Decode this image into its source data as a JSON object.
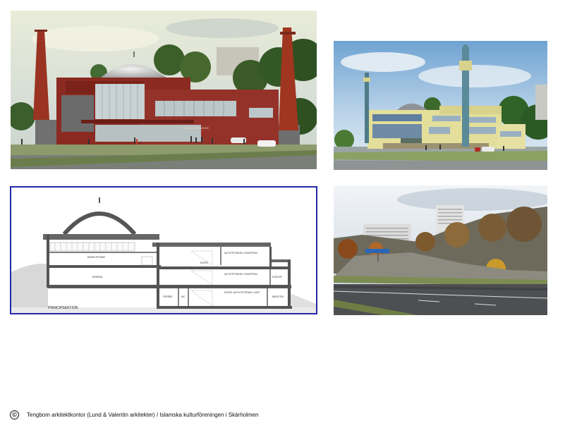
{
  "section_drawing": {
    "title": "PRINCIPSEKTION",
    "rooms": {
      "top_left": "BÖNEUTRYMME",
      "mid_left": "BÖNESAL",
      "top_right": "AKTIVITETSRUM / GRUPPRUM",
      "mid_right": "AKTIVITETSRUM / GRUPPRUM",
      "mid_far_right": "KONTOR",
      "bottom_left": "FÖRRÅD",
      "bottom_small": "WC",
      "bottom_right": "ENTRÉ / AKTIVITETSRUM / CAFÉ",
      "bottom_far_right": "BIBLIOTEK"
    },
    "small_note": "ENTRÉ"
  },
  "building_sign": "SKÄRHOLMENS MOSKÉ",
  "credit": {
    "symbol": "©",
    "text": "Tengbom arkitektkontor (Lund & Valentin arkitekter) / Islamska kulturföreningen i Skärholmen"
  }
}
